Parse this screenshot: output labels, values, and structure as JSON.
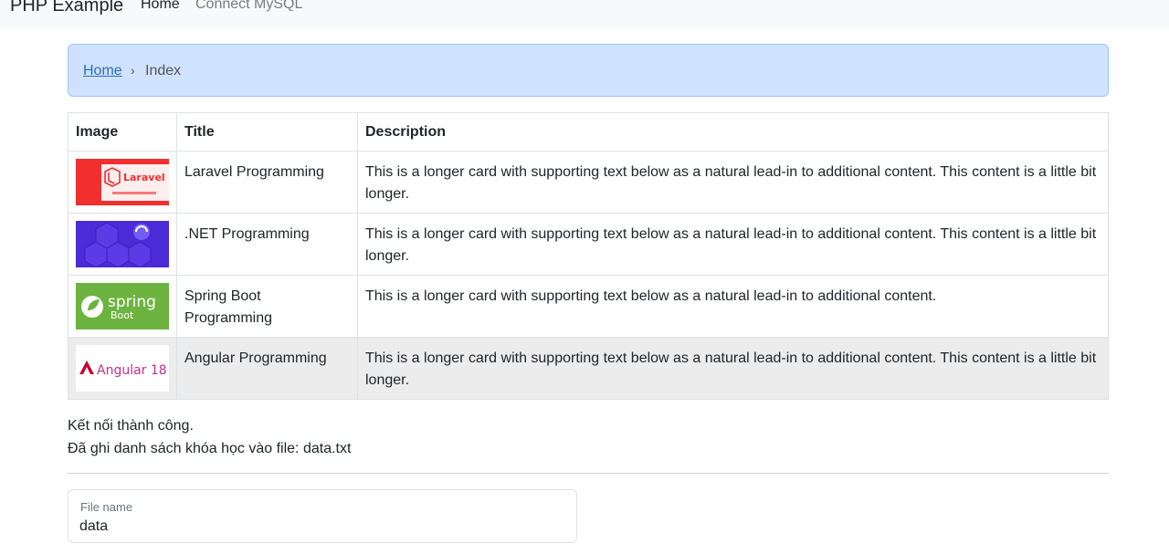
{
  "navbar": {
    "brand": "PHP Example",
    "links": [
      {
        "label": "Home"
      },
      {
        "label": "Connect MySQL"
      }
    ]
  },
  "breadcrumb": {
    "home": "Home",
    "separator": "›",
    "current": "Index"
  },
  "table": {
    "headers": [
      "Image",
      "Title",
      "Description"
    ],
    "rows": [
      {
        "image": "Laravel logo thumbnail",
        "title": "Laravel Programming",
        "description": "This is a longer card with supporting text below as a natural lead-in to additional content. This content is a little bit longer."
      },
      {
        "image": ".NET thumbnail",
        "title": ".NET Programming",
        "description": "This is a longer card with supporting text below as a natural lead-in to additional content. This content is a little bit longer."
      },
      {
        "image": "Spring Boot logo thumbnail",
        "title": "Spring Boot Programming",
        "description": "This is a longer card with supporting text below as a natural lead-in to additional content."
      },
      {
        "image": "Angular 18 logo thumbnail",
        "title": "Angular Programming",
        "description": "This is a longer card with supporting text below as a natural lead-in to additional content. This content is a little bit longer."
      }
    ]
  },
  "thumbs": {
    "laravel_word": "Laravel",
    "spring_word": "spring",
    "boot_word": "Boot",
    "angular_word": "Angular 18"
  },
  "messages": {
    "connected": "Kết nối thành công.",
    "saved": "Đã ghi danh sách khóa học vào file: data.txt"
  },
  "form": {
    "file_name_label": "File name",
    "file_name_value": "data"
  },
  "colors": {
    "breadcrumb_bg": "#cfe2ff",
    "link": "#2c6fbb",
    "laravel_red": "#f22f2f",
    "dotnet_purple": "#4b2bd6",
    "spring_green": "#6db33f",
    "angular_magenta": "#c3002f"
  }
}
